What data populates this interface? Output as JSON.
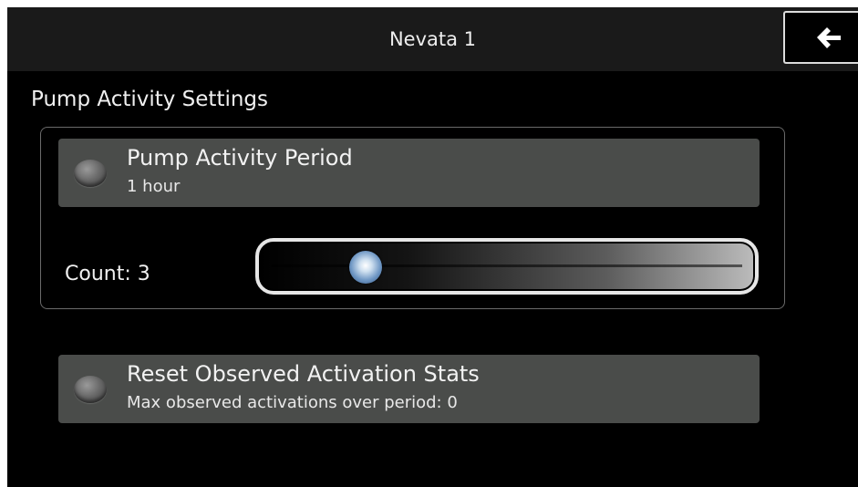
{
  "header": {
    "title": "Nevata 1",
    "back_icon": "arrow-left-icon"
  },
  "section": {
    "title": "Pump Activity Settings"
  },
  "period_item": {
    "title": "Pump Activity Period",
    "subtitle": "1 hour"
  },
  "count": {
    "label": "Count: 3",
    "slider_fraction": 0.2
  },
  "reset_item": {
    "title": "Reset Observed Activation Stats",
    "subtitle": "Max observed activations over period: 0"
  },
  "colors": {
    "background": "#000000",
    "item_bg": "#4a4c4a",
    "thumb": "#6f97c4"
  }
}
